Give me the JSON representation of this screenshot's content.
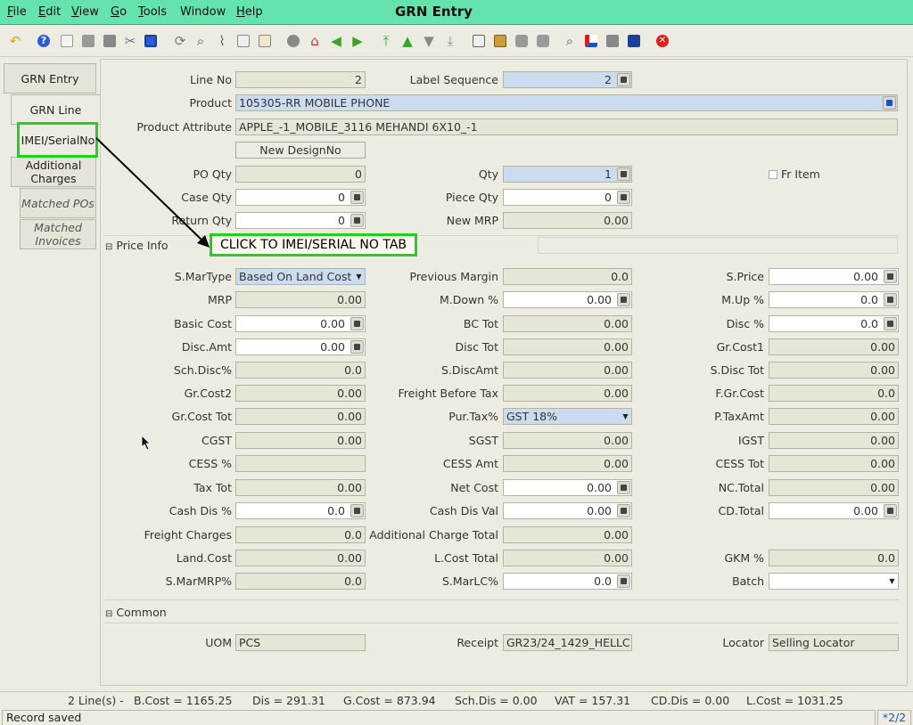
{
  "menu": {
    "file": "ile",
    "file_u": "F",
    "edit": "dit",
    "edit_u": "E",
    "view": "iew",
    "view_u": "V",
    "go": "o",
    "go_u": "G",
    "tools": "ools",
    "tools_u": "T",
    "window": "Window",
    "help": "elp",
    "help_u": "H"
  },
  "window_title": "GRN Entry",
  "tabs": {
    "grn_entry": "GRN Entry",
    "grn_line": "GRN Line",
    "imei": "IMEI/SerialNo",
    "additional_charges": "Additional Charges",
    "matched_pos": "Matched POs",
    "matched_invoices": "Matched Invoices"
  },
  "annotation": "CLICK TO IMEI/SERIAL NO TAB",
  "form": {
    "line_no_label": "Line No",
    "line_no": "2",
    "label_seq_label": "Label Sequence",
    "label_seq": "2",
    "product_label": "Product",
    "product": "105305-RR MOBILE PHONE",
    "product_attr_label": "Product Attribute",
    "product_attr": "APPLE_-1_MOBILE_3116 MEHANDI 6X10_-1",
    "new_design_btn": "New DesignNo",
    "po_qty_label": "PO Qty",
    "po_qty": "0",
    "qty_label": "Qty",
    "qty": "1",
    "fr_item_label": "Fr Item",
    "case_qty_label": "Case Qty",
    "case_qty": "0",
    "piece_qty_label": "Piece Qty",
    "piece_qty": "0",
    "return_qty_label": "Return Qty",
    "return_qty": "0",
    "new_mrp_label": "New MRP",
    "new_mrp": "0.00"
  },
  "price_info": {
    "section_label": "Price Info",
    "smartype_label": "S.MarType",
    "smartype": "Based On Land Cost",
    "prev_margin_label": "Previous Margin",
    "prev_margin": "0.0",
    "sprice_label": "S.Price",
    "sprice": "0.00",
    "mrp_label": "MRP",
    "mrp": "0.00",
    "mdown_label": "M.Down %",
    "mdown": "0.00",
    "mup_label": "M.Up %",
    "mup": "0.0",
    "basic_cost_label": "Basic Cost",
    "basic_cost": "0.00",
    "bc_tot_label": "BC Tot",
    "bc_tot": "0.00",
    "disc_pct_label": "Disc %",
    "disc_pct": "0.0",
    "disc_amt_label": "Disc.Amt",
    "disc_amt": "0.00",
    "disc_tot_label": "Disc Tot",
    "disc_tot": "0.00",
    "gr_cost1_label": "Gr.Cost1",
    "gr_cost1": "0.00",
    "sch_disc_label": "Sch.Disc%",
    "sch_disc": "0.0",
    "s_discamt_label": "S.DiscAmt",
    "s_discamt": "0.00",
    "s_disc_tot_label": "S.Disc Tot",
    "s_disc_tot": "0.00",
    "gr_cost2_label": "Gr.Cost2",
    "gr_cost2": "0.00",
    "freight_before_tax_label": "Freight Before Tax",
    "freight_before_tax": "0.00",
    "f_gr_cost_label": "F.Gr.Cost",
    "f_gr_cost": "0.0",
    "gr_cost_tot_label": "Gr.Cost Tot",
    "gr_cost_tot": "0.00",
    "pur_tax_label": "Pur.Tax%",
    "pur_tax": "GST 18%",
    "p_taxamt_label": "P.TaxAmt",
    "p_taxamt": "0.00",
    "cgst_label": "CGST",
    "cgst": "0.00",
    "sgst_label": "SGST",
    "sgst": "0.00",
    "igst_label": "IGST",
    "igst": "0.00",
    "cess_pct_label": "CESS %",
    "cess_pct": "",
    "cess_amt_label": "CESS Amt",
    "cess_amt": "0.00",
    "cess_tot_label": "CESS Tot",
    "cess_tot": "0.00",
    "tax_tot_label": "Tax Tot",
    "tax_tot": "0.00",
    "net_cost_label": "Net Cost",
    "net_cost": "0.00",
    "nc_total_label": "NC.Total",
    "nc_total": "0.00",
    "cash_dis_label": "Cash Dis %",
    "cash_dis": "0.0",
    "cash_dis_val_label": "Cash Dis Val",
    "cash_dis_val": "0.00",
    "cd_total_label": "CD.Total",
    "cd_total": "0.00",
    "freight_charges_label": "Freight Charges",
    "freight_charges": "0.0",
    "add_charge_total_label": "Additional Charge Total",
    "add_charge_total": "0.00",
    "land_cost_label": "Land.Cost",
    "land_cost": "0.00",
    "l_cost_total_label": "L.Cost Total",
    "l_cost_total": "0.00",
    "gkm_label": "GKM %",
    "gkm": "0.0",
    "s_marmrp_label": "S.MarMRP%",
    "s_marmrp": "0.0",
    "s_marlc_label": "S.MarLC%",
    "s_marlc": "0.0",
    "batch_label": "Batch",
    "batch": ""
  },
  "common": {
    "section_label": "Common",
    "uom_label": "UOM",
    "uom": "PCS",
    "receipt_label": "Receipt",
    "receipt": "GR23/24_1429_HELLC",
    "locator_label": "Locator",
    "locator": "Selling Locator"
  },
  "status": {
    "lines": "2 Line(s) -",
    "bcost": "B.Cost = 1165.25",
    "dis": "Dis = 291.31",
    "gcost": "G.Cost = 873.94",
    "schdis": "Sch.Dis = 0.00",
    "vat": "VAT = 157.31",
    "cddis": "CD.Dis = 0.00",
    "lcost": "L.Cost = 1031.25",
    "message": "Record saved",
    "pager": "*2/2"
  },
  "colors": {
    "titlebar": "#64e3ad",
    "highlight_border": "#22d01f",
    "blue_field": "#cbdcf0"
  }
}
